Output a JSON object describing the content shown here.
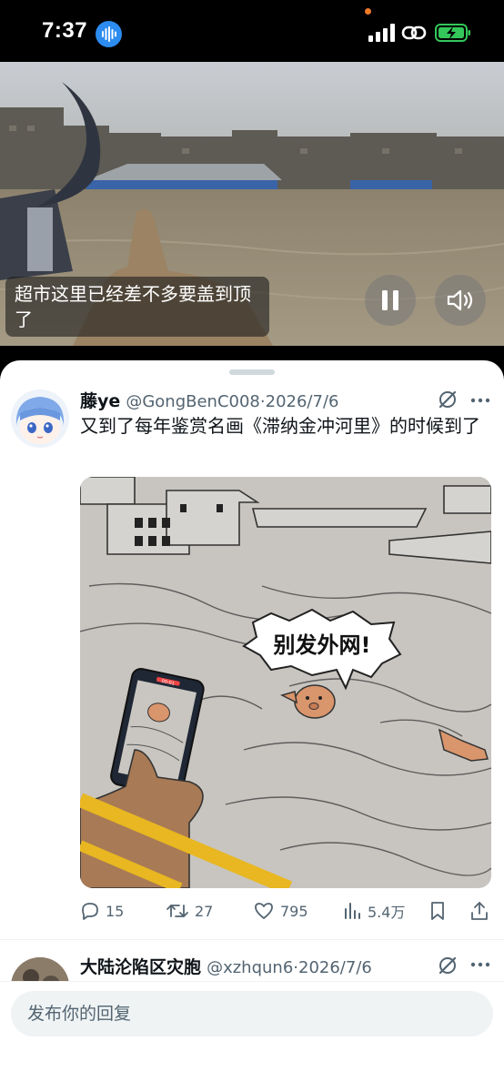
{
  "status_bar": {
    "time": "7:37",
    "icons": [
      "voice-memo-icon",
      "signal-icon",
      "personal-hotspot-icon",
      "battery-charging-icon"
    ],
    "battery_color": "#34c759"
  },
  "video": {
    "caption": "超市这里已经差不多要盖到顶了",
    "pause_label": "pause-icon",
    "sound_label": "speaker-icon"
  },
  "tweet": {
    "display_name": "藤ye",
    "handle": "@GongBenC008",
    "separator": "·",
    "date": "2026/7/6",
    "text": "又到了每年鉴赏名画《滞纳金冲河里》的时候到了",
    "image_bubble_text": "别发外网!",
    "image_phone_label": "00:01",
    "stats": {
      "replies": "15",
      "retweets": "27",
      "likes": "795",
      "views": "5.4万"
    }
  },
  "tweet2": {
    "display_name": "大陆沦陷区灾胞",
    "handle": "@xzhqun6",
    "separator": "·",
    "date": "2026/7/6"
  },
  "reply": {
    "placeholder": "发布你的回复"
  },
  "colors": {
    "text_primary": "#0f1419",
    "text_secondary": "#536471",
    "accent": "#1d9bf0"
  }
}
